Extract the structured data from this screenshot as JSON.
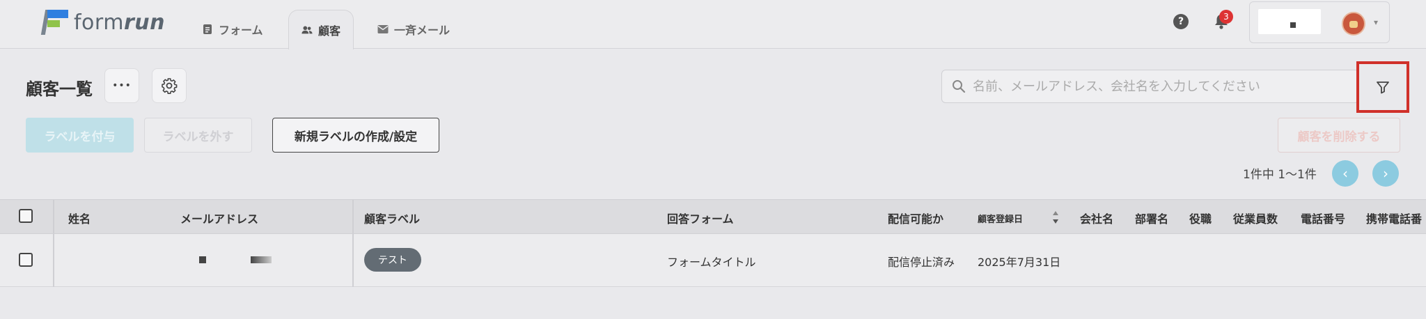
{
  "header": {
    "logo_prefix": "form",
    "logo_suffix": "run",
    "nav": [
      {
        "label": "フォーム",
        "icon": "form-icon"
      },
      {
        "label": "顧客",
        "icon": "users-icon",
        "active": true
      },
      {
        "label": "一斉メール",
        "icon": "mail-icon"
      }
    ],
    "help": "?",
    "notification_count": "3"
  },
  "toolbar": {
    "title": "顧客一覧",
    "more": "•••",
    "search_placeholder": "名前、メールアドレス、会社名を入力してください",
    "add_label": "ラベルを付与",
    "remove_label": "ラベルを外す",
    "new_label": "新規ラベルの作成/設定",
    "delete": "顧客を削除する",
    "pager": "1件中 1〜1件",
    "prev": "‹",
    "next": "›"
  },
  "table": {
    "columns": [
      "姓名",
      "メールアドレス",
      "顧客ラベル",
      "回答フォーム",
      "配信可能か",
      "顧客登録日",
      "会社名",
      "部署名",
      "役職",
      "従業員数",
      "電話番号",
      "携帯電話番"
    ],
    "rows": [
      {
        "label": "テスト",
        "form": "フォームタイトル",
        "delivery": "配信停止済み",
        "registered": "2025年7月31日"
      }
    ]
  },
  "colors": {
    "accent": "#8ccbe0",
    "highlight": "#d0302a",
    "label_chip": "#636c74",
    "badge": "#dd3333"
  }
}
